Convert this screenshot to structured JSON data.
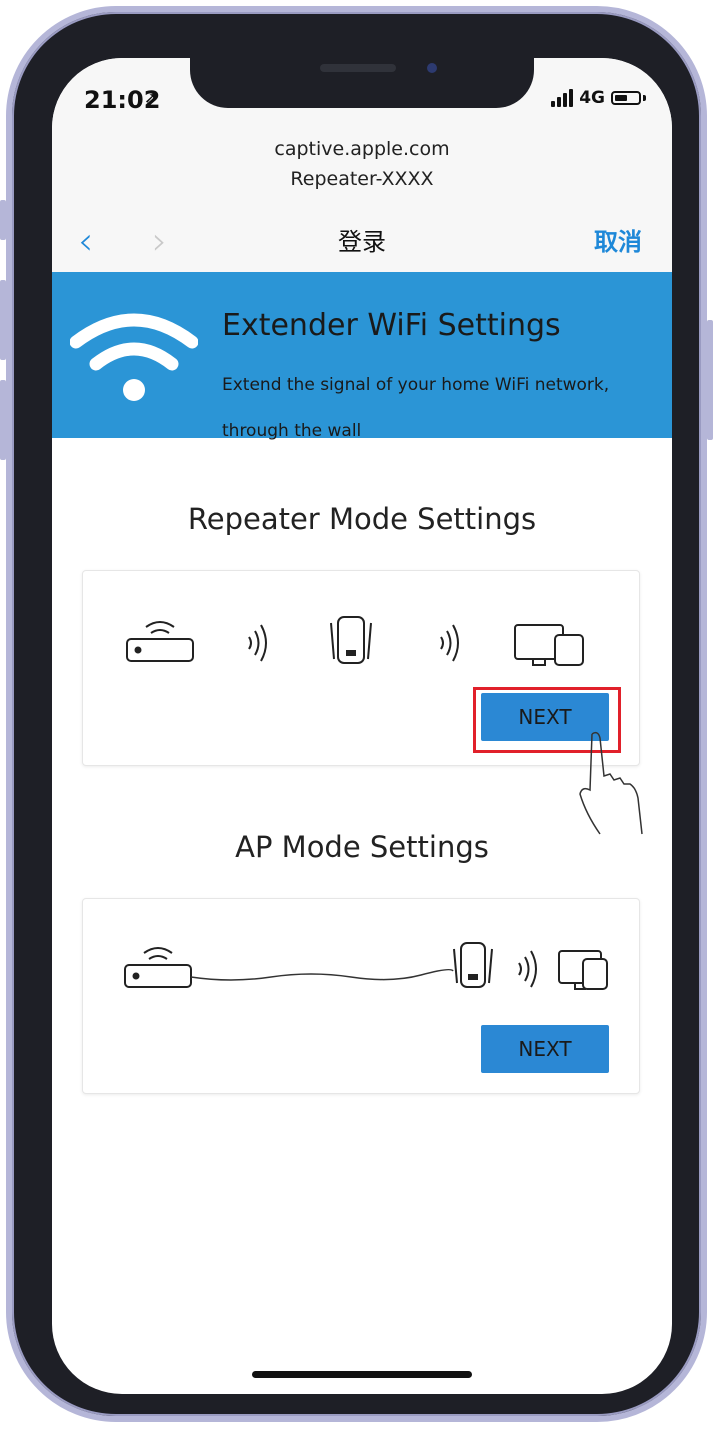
{
  "status_bar": {
    "time": "21:02",
    "network": "4G"
  },
  "address_bar": {
    "domain": "captive.apple.com",
    "page": "Repeater-XXXX"
  },
  "nav_bar": {
    "title": "登录",
    "cancel_label": "取消"
  },
  "banner": {
    "title": "Extender WiFi Settings",
    "subtitle": "Extend the signal of your home WiFi network, through the wall"
  },
  "repeater_section": {
    "title": "Repeater Mode Settings",
    "next_label": "NEXT"
  },
  "ap_section": {
    "title": "AP Mode Settings",
    "next_label": "NEXT"
  },
  "colors": {
    "accent": "#2b95d6",
    "button": "#2b88d4",
    "highlight": "#e1202a",
    "frame": "#b5b6d8"
  }
}
